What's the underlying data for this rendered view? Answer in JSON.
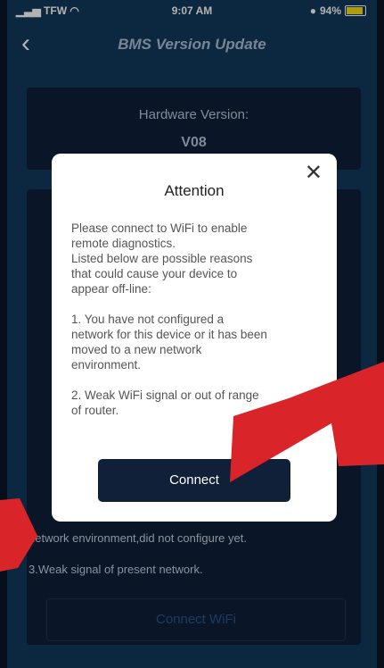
{
  "status_bar": {
    "carrier": "TFW",
    "time": "9:07 AM",
    "battery": "94%"
  },
  "nav": {
    "title": "BMS Version Update"
  },
  "hardware": {
    "label": "Hardware Version:",
    "value": "V08"
  },
  "background_list": {
    "line2_tail": "network environment,did not configure yet.",
    "reason3": "3.Weak signal of present network.",
    "connect_wifi_label": "Connect WiFi"
  },
  "modal": {
    "title": "Attention",
    "intro_lines": [
      "Please connect to WiFi to enable",
      "remote diagnostics.",
      "Listed below are possible reasons",
      "that could cause your device to",
      "appear off-line:"
    ],
    "reason1_lines": [
      "1. You have not configured a",
      "network for this device or it has been",
      "moved to a new network",
      "environment."
    ],
    "reason2_lines": [
      "2. Weak WiFi signal or out of range",
      "of router."
    ],
    "button_label": "Connect"
  },
  "colors": {
    "arrow": "#d9242a",
    "accent_dark": "#0f2038"
  }
}
